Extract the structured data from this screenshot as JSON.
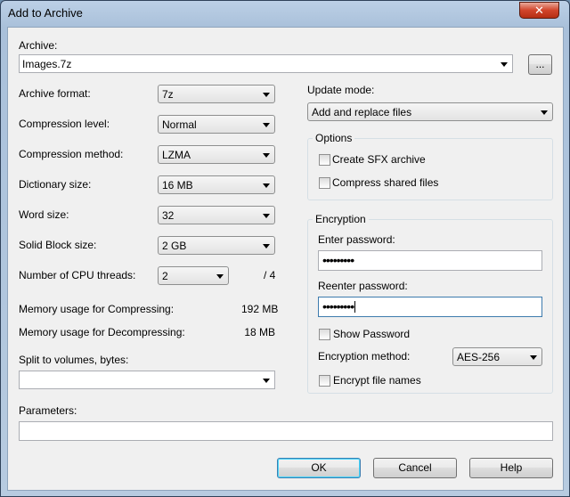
{
  "window": {
    "title": "Add to Archive",
    "close_glyph": "✕"
  },
  "archive": {
    "label": "Archive:",
    "value": "Images.7z",
    "browse_label": "..."
  },
  "left": {
    "format": {
      "label": "Archive format:",
      "value": "7z"
    },
    "level": {
      "label": "Compression level:",
      "value": "Normal"
    },
    "method": {
      "label": "Compression method:",
      "value": "LZMA"
    },
    "dict": {
      "label": "Dictionary size:",
      "value": "16 MB"
    },
    "word": {
      "label": "Word size:",
      "value": "32"
    },
    "solid": {
      "label": "Solid Block size:",
      "value": "2 GB"
    },
    "threads": {
      "label": "Number of CPU threads:",
      "value": "2",
      "max": "/ 4"
    },
    "mem_comp": {
      "label": "Memory usage for Compressing:",
      "value": "192 MB"
    },
    "mem_decomp": {
      "label": "Memory usage for Decompressing:",
      "value": "18 MB"
    },
    "split": {
      "label": "Split to volumes, bytes:",
      "value": ""
    },
    "params": {
      "label": "Parameters:",
      "value": ""
    }
  },
  "right": {
    "update": {
      "label": "Update mode:",
      "value": "Add and replace files"
    },
    "options": {
      "title": "Options",
      "sfx": "Create SFX archive",
      "shared": "Compress shared files"
    },
    "encryption": {
      "title": "Encryption",
      "enter_label": "Enter password:",
      "enter_value": "•••••••••",
      "reenter_label": "Reenter password:",
      "reenter_value": "•••••••••",
      "show_password": "Show Password",
      "method_label": "Encryption method:",
      "method_value": "AES-256",
      "encrypt_names": "Encrypt file names"
    }
  },
  "buttons": {
    "ok": "OK",
    "cancel": "Cancel",
    "help": "Help"
  }
}
